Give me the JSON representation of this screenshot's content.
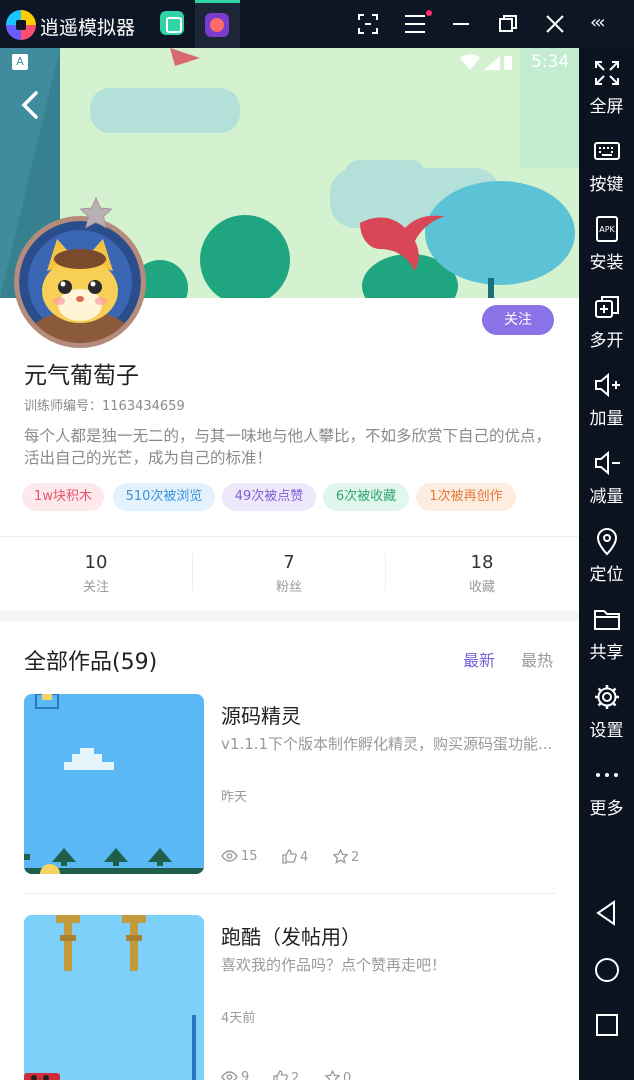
{
  "emulator": {
    "title": "逍遥模拟器",
    "expand_label": "‹‹‹",
    "sidebar": [
      {
        "label": "全屏",
        "icon": "fullscreen-icon"
      },
      {
        "label": "按键",
        "icon": "keyboard-icon"
      },
      {
        "label": "安装",
        "icon": "apk-icon"
      },
      {
        "label": "多开",
        "icon": "multi-instance-icon"
      },
      {
        "label": "加量",
        "icon": "volume-up-icon"
      },
      {
        "label": "减量",
        "icon": "volume-down-icon"
      },
      {
        "label": "定位",
        "icon": "location-icon"
      },
      {
        "label": "共享",
        "icon": "folder-icon"
      },
      {
        "label": "设置",
        "icon": "gear-icon"
      },
      {
        "label": "更多",
        "icon": "more-icon"
      }
    ]
  },
  "status_bar": {
    "apk_badge": "A",
    "time": "5:34"
  },
  "profile": {
    "follow_label": "关注",
    "name": "元气葡萄子",
    "trainer_id": "训练师编号：1163434659",
    "bio": "每个人都是独一无二的，与其一味地与他人攀比，不如多欣赏下自己的优点，活出自己的光芒，成为自己的标准！",
    "tags": [
      {
        "text": "1w块积木",
        "color": "#e4546a",
        "bg": "#fde8ec"
      },
      {
        "text": "510次被浏览",
        "color": "#3d93d9",
        "bg": "#e3f2fd"
      },
      {
        "text": "49次被点赞",
        "color": "#7f5fd6",
        "bg": "#eee8fb"
      },
      {
        "text": "6次被收藏",
        "color": "#2fa86f",
        "bg": "#e1f6ec"
      },
      {
        "text": "1次被再创作",
        "color": "#e37a3a",
        "bg": "#fdece0"
      }
    ]
  },
  "stats": [
    {
      "value": "10",
      "label": "关注"
    },
    {
      "value": "7",
      "label": "粉丝"
    },
    {
      "value": "18",
      "label": "收藏"
    }
  ],
  "works": {
    "title": "全部作品(59)",
    "sort_latest": "最新",
    "sort_hot": "最热",
    "accent": "#7a62d6",
    "items": [
      {
        "title": "源码精灵",
        "desc": "v1.1.1下个版本制作孵化精灵，购买源码蛋功能...",
        "date": "昨天",
        "views": "15",
        "likes": "4",
        "favs": "2"
      },
      {
        "title": "跑酷（发帖用）",
        "desc": "喜欢我的作品吗？点个赞再走吧！",
        "date": "4天前",
        "views": "9",
        "likes": "2",
        "favs": "0"
      }
    ]
  }
}
